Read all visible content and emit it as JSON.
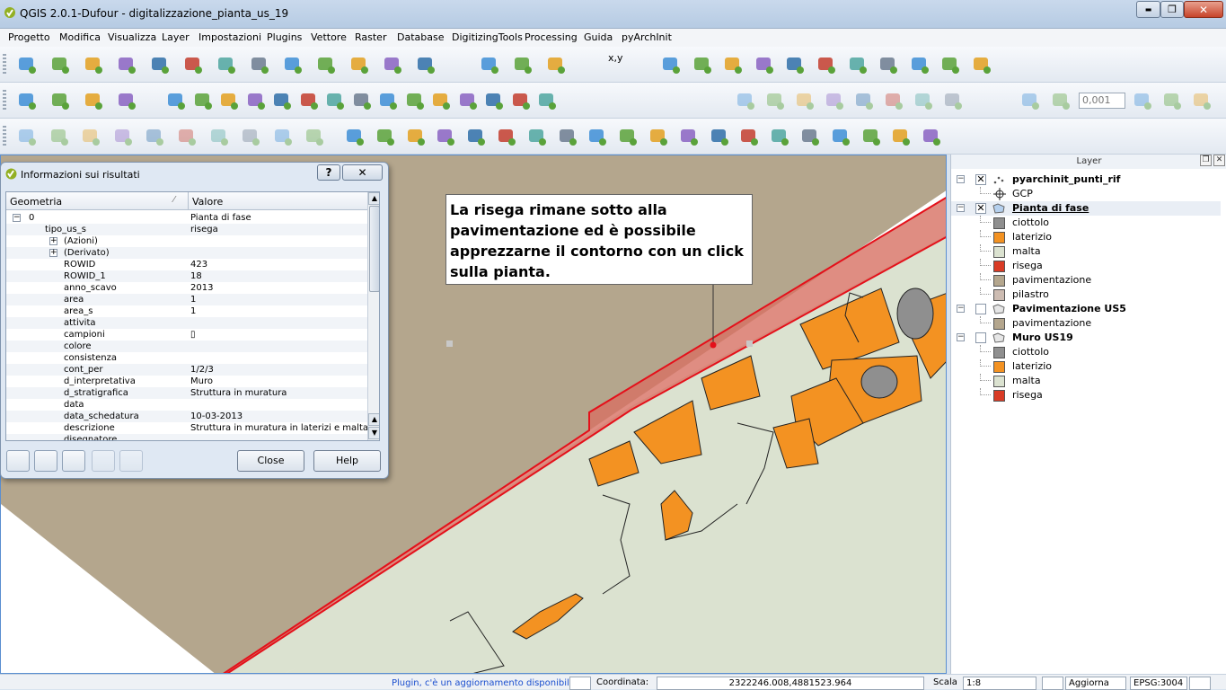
{
  "window": {
    "title": "QGIS 2.0.1-Dufour - digitalizzazione_pianta_us_19",
    "minimize_glyph": "▬",
    "maximize_glyph": "❐",
    "close_glyph": "✕"
  },
  "menu": [
    "Progetto",
    "Modifica",
    "Visualizza",
    "Layer",
    "Impostazioni",
    "Plugins",
    "Vettore",
    "Raster",
    "Database",
    "DigitizingTools",
    "Processing",
    "Guida",
    "pyArchInit"
  ],
  "toolbar": {
    "coords_label": "x,y",
    "snapping_tolerance": "0,001",
    "icons_row1": [
      "add-vector-icon",
      "add-raster-icon",
      "add-postgis-icon",
      "add-spatialite-icon",
      "add-mssql-icon",
      "add-wms-icon",
      "add-wcs-icon",
      "add-wfs-icon",
      "add-delimited-icon",
      "add-oracle-icon",
      "new-layer-icon",
      "new-shapefile-icon",
      "remove-layer-icon",
      "globe-icon",
      "plugin-icon",
      "settings-icon",
      "pan-icon",
      "pan-to-selection-icon",
      "zoom-in-icon",
      "zoom-out-icon",
      "zoom-native-icon",
      "zoom-full-icon",
      "zoom-layer-icon",
      "zoom-selection-icon",
      "zoom-last-icon",
      "zoom-next-icon",
      "refresh-icon"
    ],
    "icons_row2": [
      "html-icon",
      "python-icon",
      "help-icon",
      "pyarchinit-icon",
      "identify-icon",
      "select-feature-icon",
      "select-dropdown-icon",
      "deselect-icon",
      "expression-icon",
      "attribute-table-icon",
      "field-calculator-icon",
      "measure-icon",
      "annotation-icon",
      "text-annotation-icon",
      "label-icon",
      "digitize-icon",
      "rollback-icon",
      "save-edits-icon",
      "database-icon",
      "pencil-icon",
      "edit-icon",
      "save-icon",
      "add-feature-icon",
      "move-feature-icon",
      "node-tool-icon",
      "delete-selected-icon",
      "cut-icon",
      "copy-icon",
      "paste-icon",
      "simplify-icon",
      "add-ring-icon",
      "add-part-icon"
    ],
    "icons_row3": [
      "reshape-icon",
      "offset-icon",
      "split-icon",
      "merge-icon",
      "rotate-icon",
      "fill-ring-icon",
      "vertex-icon",
      "curve-icon",
      "split-parts-icon",
      "delete-part-icon",
      "tree-icon",
      "scroll-icon",
      "house-icon",
      "us-form-icon",
      "pottery-icon",
      "tomb-icon",
      "skeleton-icon",
      "gender-icon",
      "family-icon",
      "structure-icon",
      "run-icon",
      "info-icon",
      "arrows-icon",
      "camera-icon",
      "print-icon",
      "pdf-icon",
      "report-icon",
      "config-icon",
      "help-sphere-icon",
      "package-icon"
    ]
  },
  "results": {
    "title": "Informazioni sui risultati",
    "help_glyph": "?",
    "close_glyph": "✕",
    "columns": [
      "Geometria",
      "Valore"
    ],
    "rows": [
      {
        "indent": 0,
        "expander": "−",
        "key": "0",
        "value": "Pianta di fase"
      },
      {
        "indent": 1,
        "expander": "",
        "key": "tipo_us_s",
        "value": "risega"
      },
      {
        "indent": 2,
        "expander": "+",
        "key": "(Azioni)",
        "value": ""
      },
      {
        "indent": 2,
        "expander": "+",
        "key": "(Derivato)",
        "value": ""
      },
      {
        "indent": 2,
        "expander": "",
        "key": "ROWID",
        "value": "423"
      },
      {
        "indent": 2,
        "expander": "",
        "key": "ROWID_1",
        "value": "18"
      },
      {
        "indent": 2,
        "expander": "",
        "key": "anno_scavo",
        "value": "2013"
      },
      {
        "indent": 2,
        "expander": "",
        "key": "area",
        "value": "1"
      },
      {
        "indent": 2,
        "expander": "",
        "key": "area_s",
        "value": "1"
      },
      {
        "indent": 2,
        "expander": "",
        "key": "attivita",
        "value": ""
      },
      {
        "indent": 2,
        "expander": "",
        "key": "campioni",
        "value": "▯"
      },
      {
        "indent": 2,
        "expander": "",
        "key": "colore",
        "value": ""
      },
      {
        "indent": 2,
        "expander": "",
        "key": "consistenza",
        "value": ""
      },
      {
        "indent": 2,
        "expander": "",
        "key": "cont_per",
        "value": "1/2/3"
      },
      {
        "indent": 2,
        "expander": "",
        "key": "d_interpretativa",
        "value": "Muro"
      },
      {
        "indent": 2,
        "expander": "",
        "key": "d_stratigrafica",
        "value": "Struttura in muratura"
      },
      {
        "indent": 2,
        "expander": "",
        "key": "data",
        "value": ""
      },
      {
        "indent": 2,
        "expander": "",
        "key": "data_schedatura",
        "value": "10-03-2013"
      },
      {
        "indent": 2,
        "expander": "",
        "key": "descrizione",
        "value": "Struttura in muratura in laterizi e malta."
      },
      {
        "indent": 2,
        "expander": "",
        "key": "disegnatore",
        "value": ""
      }
    ],
    "scroll_up": "▲",
    "scroll_down": "▼",
    "close_button": "Close",
    "help_button": "Help",
    "action_icons": [
      "expand-all-icon",
      "collapse-all-icon",
      "highlight-icon",
      "copy-feature-icon",
      "print-icon"
    ]
  },
  "annotation": {
    "text": "La risega rimane sotto alla pavimentazione ed è possibile apprezzarne il contorno con un click sulla pianta."
  },
  "layers": {
    "panel_title": "Layer",
    "float_glyph": "❐",
    "close_glyph": "✕",
    "groups": [
      {
        "name": "pyarchinit_punti_rif",
        "checked": "✕",
        "expander": "−",
        "symbols": [
          {
            "label": "GCP",
            "color": ""
          }
        ]
      },
      {
        "name": "Pianta di fase",
        "checked": "✕",
        "expander": "−",
        "symbols": [
          {
            "label": "ciottolo",
            "color": "#8f8f8f"
          },
          {
            "label": "laterizio",
            "color": "#f39222"
          },
          {
            "label": "malta",
            "color": "#dbe2d0"
          },
          {
            "label": "risega",
            "color": "#d93b25"
          },
          {
            "label": "pavimentazione",
            "color": "#b4a68d"
          },
          {
            "label": "pilastro",
            "color": "#cdbcb2"
          }
        ]
      },
      {
        "name": "Pavimentazione US5",
        "checked": "",
        "expander": "−",
        "symbols": [
          {
            "label": "pavimentazione",
            "color": "#b4a68d"
          }
        ]
      },
      {
        "name": "Muro US19",
        "checked": "",
        "expander": "−",
        "symbols": [
          {
            "label": "ciottolo",
            "color": "#8f8f8f"
          },
          {
            "label": "laterizio",
            "color": "#f39222"
          },
          {
            "label": "malta",
            "color": "#dbe2d0"
          },
          {
            "label": "risega",
            "color": "#d93b25"
          }
        ]
      }
    ]
  },
  "status": {
    "plugin_message": "Plugin, c'è un aggiornamento disponibile",
    "coordinate_label": "Coordinata:",
    "coordinate_value": "2322246.008,4881523.964",
    "scale_label": "Scala",
    "scale_value": "1:8",
    "render_label": "Aggiorna",
    "crs": "EPSG:3004"
  },
  "colors": {
    "pavimentazione": "#b4a68d",
    "laterizio": "#f39222",
    "malta": "#dbe2d0",
    "risega": "#d93b25",
    "ciottolo": "#8f8f8f"
  }
}
